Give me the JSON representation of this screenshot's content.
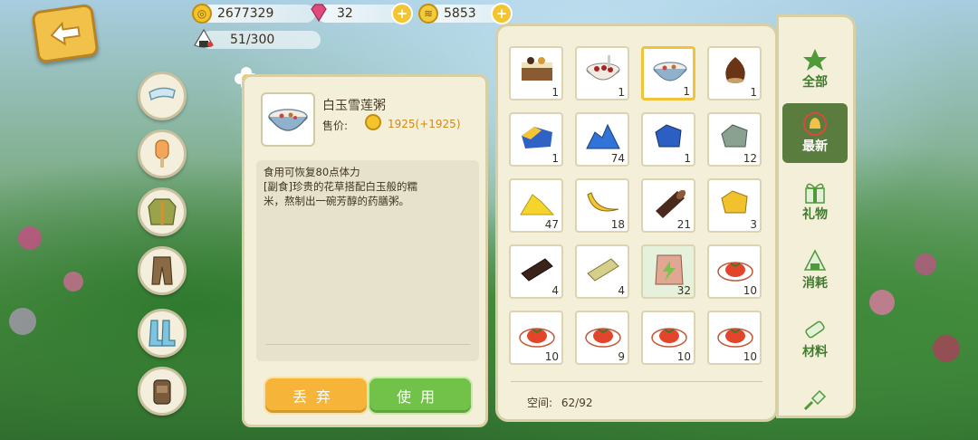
{
  "resources": {
    "gold": "2677329",
    "gems": "32",
    "tickets": "5853",
    "bag_capacity": "51/300"
  },
  "detail": {
    "name": "白玉雪莲粥",
    "price_label": "售价:",
    "price_value": "1925(+1925)",
    "desc_line1": "食用可恢复80点体力",
    "desc_line2": "[副食]珍贵的花草搭配白玉般的糯",
    "desc_line3": "米，熬制出一碗芳醇的药膳粥。",
    "discard_label": "丢弃",
    "use_label": "使用"
  },
  "inventory": {
    "items": [
      {
        "icon": "cake-slice-icon",
        "count": "1"
      },
      {
        "icon": "red-bean-porridge-icon",
        "count": "1"
      },
      {
        "icon": "lotus-porridge-icon",
        "count": "1",
        "selected": true
      },
      {
        "icon": "chestnut-icon",
        "count": "1"
      },
      {
        "icon": "blue-yellow-ore-icon",
        "count": "1"
      },
      {
        "icon": "blue-crystal-pile-icon",
        "count": "74"
      },
      {
        "icon": "blue-ore-icon",
        "count": "1"
      },
      {
        "icon": "grey-ore-icon",
        "count": "12"
      },
      {
        "icon": "yellow-sand-icon",
        "count": "47"
      },
      {
        "icon": "banana-icon",
        "count": "18"
      },
      {
        "icon": "dark-wood-log-icon",
        "count": "21"
      },
      {
        "icon": "gold-ore-icon",
        "count": "3"
      },
      {
        "icon": "dark-chocolate-icon",
        "count": "4"
      },
      {
        "icon": "wood-plank-icon",
        "count": "4"
      },
      {
        "icon": "fertilizer-bag-icon",
        "count": "32",
        "highlight": true
      },
      {
        "icon": "tomato-dish-icon",
        "count": "10"
      },
      {
        "icon": "tomato-dish-icon",
        "count": "10"
      },
      {
        "icon": "tomato-dish-icon",
        "count": "9"
      },
      {
        "icon": "tomato-dish-icon",
        "count": "10"
      },
      {
        "icon": "tomato-dish-icon",
        "count": "10"
      }
    ],
    "space_label": "空间:",
    "space_value": "62/92"
  },
  "tabs": [
    {
      "label": "全部",
      "icon": "star-icon"
    },
    {
      "label": "最新",
      "icon": "bell-icon",
      "active": true
    },
    {
      "label": "礼物",
      "icon": "gift-icon"
    },
    {
      "label": "消耗",
      "icon": "rice-ball-icon"
    },
    {
      "label": "材料",
      "icon": "scroll-icon"
    },
    {
      "label": "",
      "icon": "shovel-icon"
    }
  ],
  "colors": {
    "panel": "#f3efd8",
    "accent_yellow": "#f6b538",
    "accent_green": "#72c24a",
    "active_tab": "#5a7c3e"
  }
}
